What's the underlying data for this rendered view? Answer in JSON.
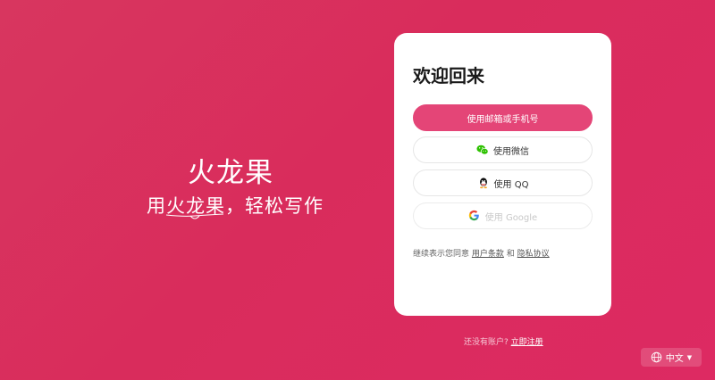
{
  "brand": {
    "title": "火龙果",
    "slogan": "用火龙果，轻松写作"
  },
  "login": {
    "title": "欢迎回来",
    "email_phone_button": "使用邮箱或手机号",
    "wechat_button": "使用微信",
    "qq_button": "使用 QQ",
    "google_button": "使用 Google",
    "terms_prefix": "继续表示您同意",
    "terms_link": "用户条款",
    "terms_and": "和",
    "privacy_link": "隐私协议"
  },
  "signup": {
    "prompt": "还没有账户?",
    "link": "立即注册"
  },
  "language": {
    "current": "中文"
  },
  "icons": {
    "wechat": "wechat-icon",
    "qq": "qq-icon",
    "google": "google-icon",
    "globe": "globe-icon",
    "caret": "caret-down-icon"
  },
  "colors": {
    "background": "#d92c5c",
    "primary_button": "#e44577",
    "wechat_green": "#2dc100"
  }
}
